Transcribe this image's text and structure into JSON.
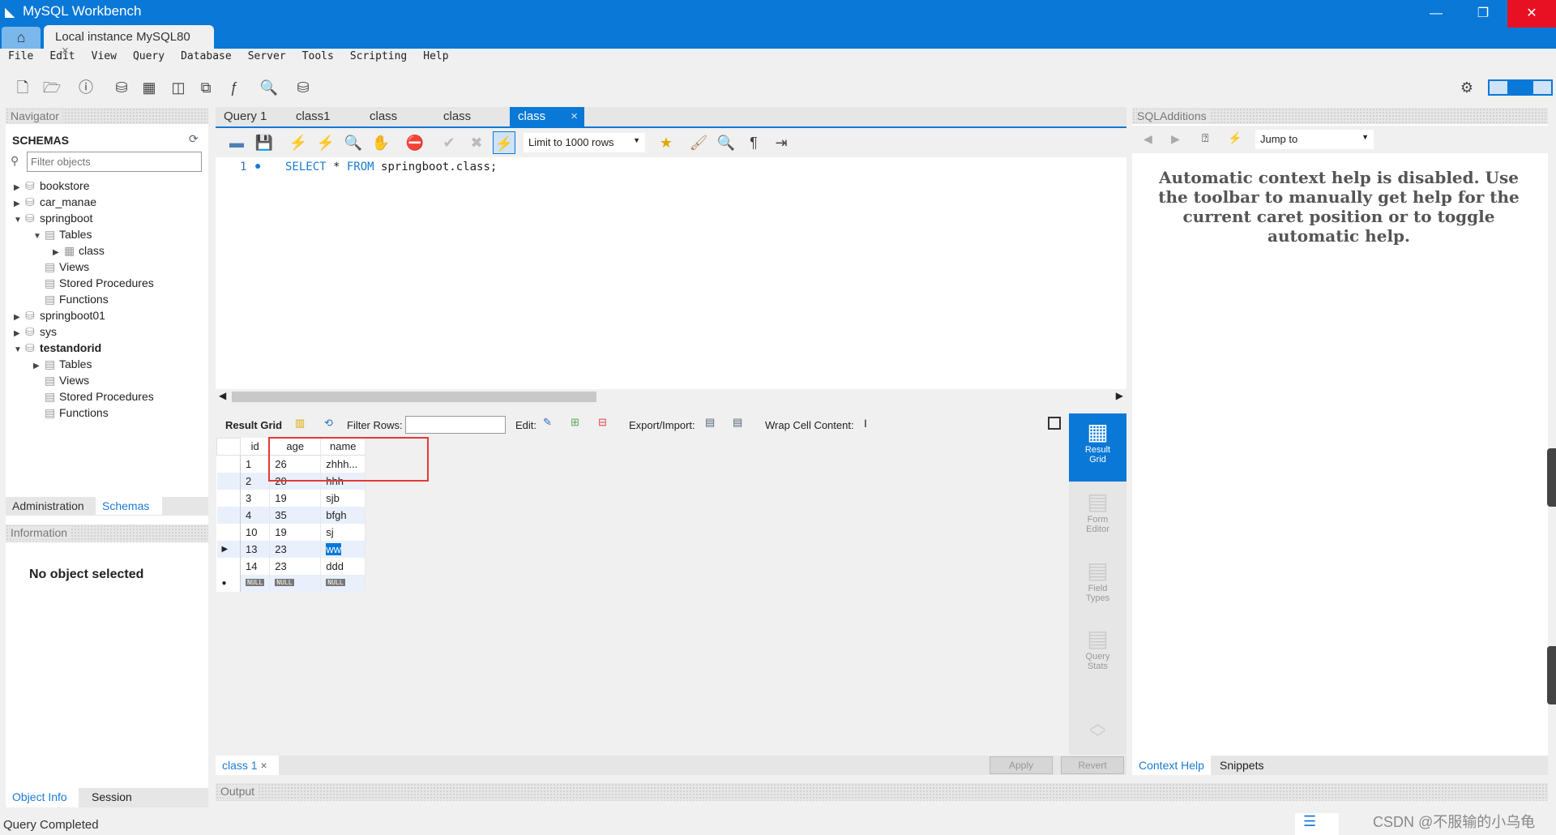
{
  "window": {
    "title": "MySQL Workbench",
    "connection_tab": "Local instance MySQL80"
  },
  "menu": [
    "File",
    "Edit",
    "View",
    "Query",
    "Database",
    "Server",
    "Tools",
    "Scripting",
    "Help"
  ],
  "navigator": {
    "header": "Navigator",
    "schemas_label": "SCHEMAS",
    "filter_placeholder": "Filter objects",
    "tree": [
      {
        "label": "bookstore",
        "level": 0,
        "expanded": false,
        "type": "schema"
      },
      {
        "label": "car_manae",
        "level": 0,
        "expanded": false,
        "type": "schema"
      },
      {
        "label": "springboot",
        "level": 0,
        "expanded": true,
        "type": "schema"
      },
      {
        "label": "Tables",
        "level": 1,
        "expanded": true,
        "type": "folder"
      },
      {
        "label": "class",
        "level": 2,
        "expanded": false,
        "type": "table"
      },
      {
        "label": "Views",
        "level": 1,
        "type": "folder"
      },
      {
        "label": "Stored Procedures",
        "level": 1,
        "type": "folder"
      },
      {
        "label": "Functions",
        "level": 1,
        "type": "folder"
      },
      {
        "label": "springboot01",
        "level": 0,
        "expanded": false,
        "type": "schema"
      },
      {
        "label": "sys",
        "level": 0,
        "expanded": false,
        "type": "schema"
      },
      {
        "label": "testandorid",
        "level": 0,
        "expanded": true,
        "type": "schema",
        "bold": true
      },
      {
        "label": "Tables",
        "level": 1,
        "expanded": false,
        "type": "folder"
      },
      {
        "label": "Views",
        "level": 1,
        "type": "folder"
      },
      {
        "label": "Stored Procedures",
        "level": 1,
        "type": "folder"
      },
      {
        "label": "Functions",
        "level": 1,
        "type": "folder"
      }
    ],
    "tabs": [
      "Administration",
      "Schemas"
    ],
    "information_header": "Information",
    "no_object": "No object selected",
    "bottom_tabs": [
      "Object Info",
      "Session"
    ]
  },
  "query_tabs": [
    "Query 1",
    "class1",
    "class",
    "class",
    "class"
  ],
  "editor": {
    "limit": "Limit to 1000 rows",
    "line_number": "1",
    "sql_keyword1": "SELECT",
    "sql_star": " * ",
    "sql_keyword2": "FROM",
    "sql_rest": " springboot.class;"
  },
  "result_toolbar": {
    "result_grid": "Result Grid",
    "filter_rows": "Filter Rows:",
    "edit": "Edit:",
    "export_import": "Export/Import:",
    "wrap": "Wrap Cell Content:"
  },
  "grid": {
    "columns": [
      "id",
      "age",
      "name"
    ],
    "rows": [
      [
        "1",
        "26",
        "zhhh..."
      ],
      [
        "2",
        "20",
        "hhh"
      ],
      [
        "3",
        "19",
        "sjb"
      ],
      [
        "4",
        "35",
        " bfgh"
      ],
      [
        "10",
        "19",
        "sj"
      ],
      [
        "13",
        "23",
        "ww"
      ],
      [
        "14",
        "23",
        "ddd"
      ]
    ],
    "null_label": "NULL",
    "selected_row": 5,
    "highlight_color": "#e53935"
  },
  "side_buttons": [
    "Result Grid",
    "Form Editor",
    "Field Types",
    "Query Stats"
  ],
  "result_tab": "class 1",
  "apply": "Apply",
  "revert": "Revert",
  "output_header": "Output",
  "sql_additions": {
    "header": "SQLAdditions",
    "jump_to": "Jump to",
    "help_text": "Automatic context help is disabled. Use the toolbar to manually get help for the current caret position or to toggle automatic help.",
    "tabs": [
      "Context Help",
      "Snippets"
    ]
  },
  "status": "Query Completed",
  "watermark": "CSDN @不服输的小乌龟",
  "colors": {
    "accent": "#0a78d7"
  }
}
